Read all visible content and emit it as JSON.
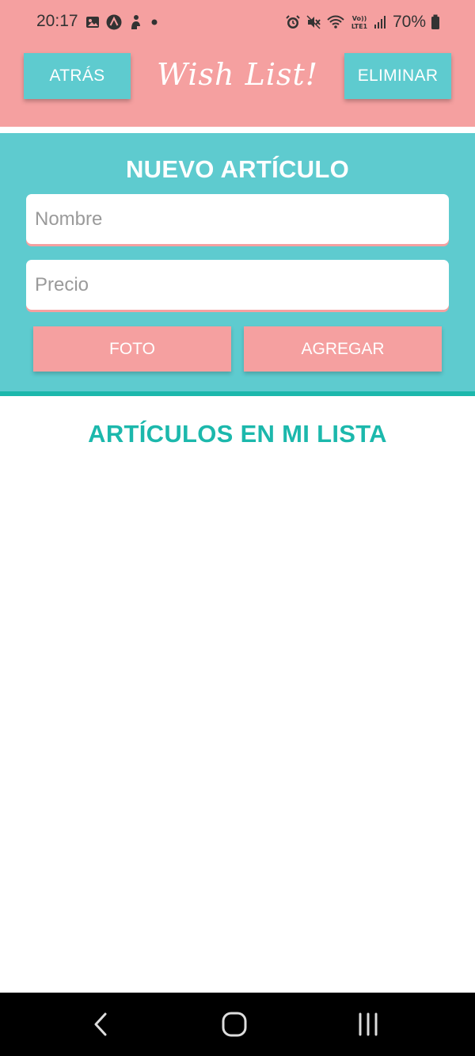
{
  "status_bar": {
    "time": "20:17",
    "battery_percent_label": "70%",
    "left_icons": [
      "image-icon",
      "app-a-icon",
      "figure-icon",
      "dot-icon"
    ],
    "right_icons": [
      "alarm-icon",
      "mute-icon",
      "wifi-icon",
      "volte-icon",
      "signal-icon",
      "battery-icon"
    ],
    "volte_label": "Vo)) LTE1"
  },
  "header": {
    "back_label": "ATRÁS",
    "title": "Wish List!",
    "delete_label": "ELIMINAR"
  },
  "new_item": {
    "title": "NUEVO ARTÍCULO",
    "name_placeholder": "Nombre",
    "name_value": "",
    "price_placeholder": "Precio",
    "price_value": "",
    "photo_label": "FOTO",
    "add_label": "AGREGAR"
  },
  "list": {
    "title": "ARTÍCULOS EN MI LISTA",
    "items": []
  },
  "colors": {
    "pink": "#f5a0a0",
    "teal": "#5ecbcf",
    "teal_dark": "#1cb8ac"
  },
  "nav_bar": {
    "icons": [
      "back-icon",
      "home-icon",
      "recents-icon"
    ]
  }
}
